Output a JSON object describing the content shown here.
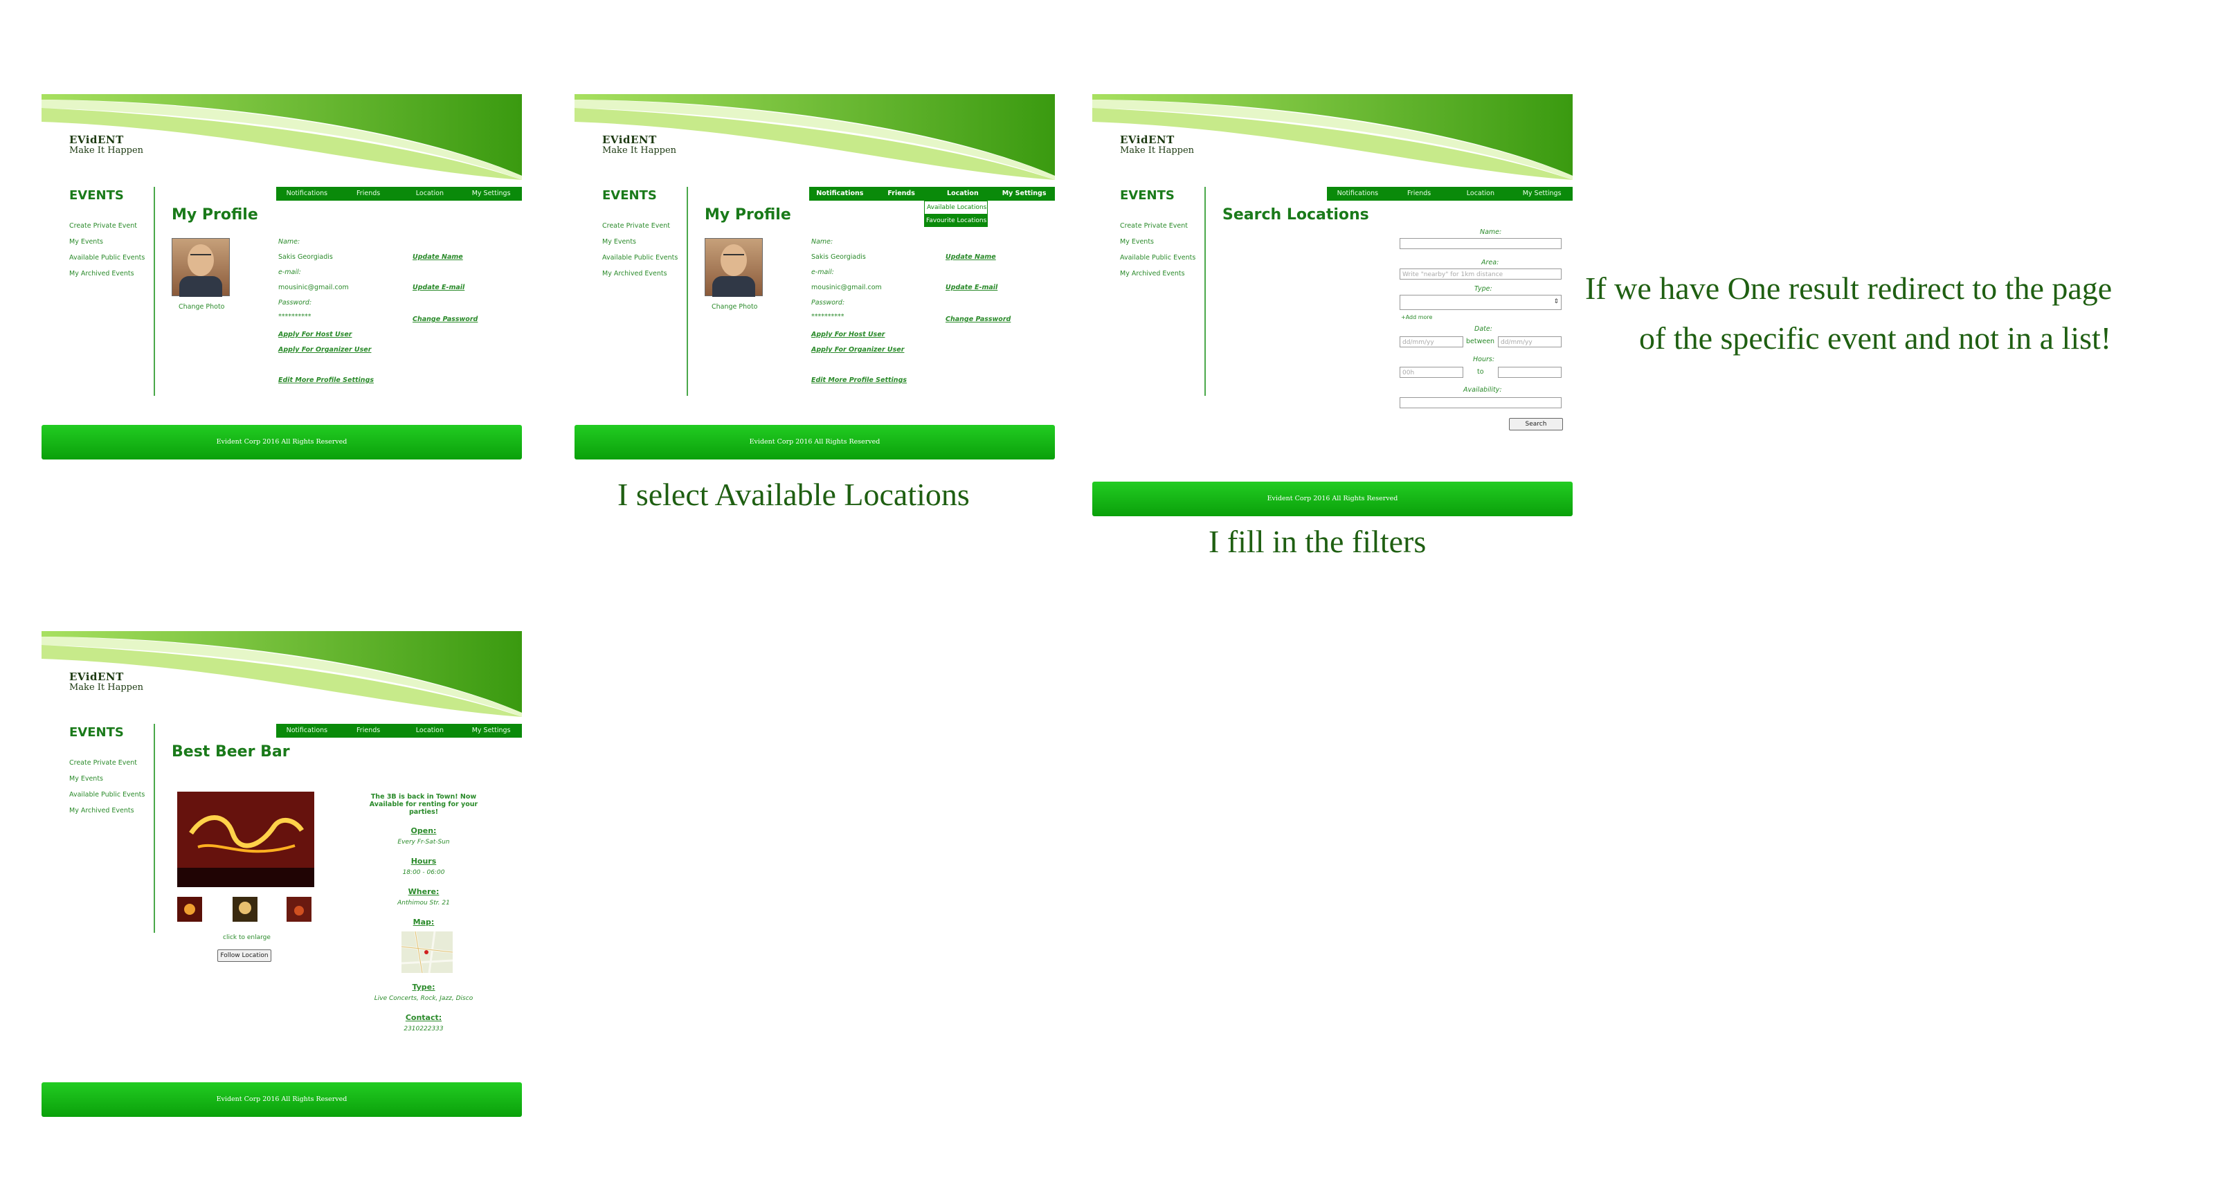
{
  "brand": {
    "name": "EVidENT",
    "slogan": "Make It Happen"
  },
  "sidebar": {
    "title": "EVENTS",
    "links": [
      "Create Private Event",
      "My Events",
      "Available Public Events",
      "My Archived Events"
    ]
  },
  "nav": [
    "Notifications",
    "Friends",
    "Location",
    "My Settings"
  ],
  "footer": "Evident Corp  2016 All Rights Reserved",
  "profile": {
    "title": "My Profile",
    "change_photo": "Change Photo",
    "name_label": "Name:",
    "name_value": "Sakis Georgiadis",
    "email_label": "e-mail:",
    "email_value": "mousinic@gmail.com",
    "password_label": "Password:",
    "password_value": "**********",
    "update_name": "Update Name",
    "update_email": "Update E-mail",
    "change_password": "Change Password",
    "apply_host": "Apply For Host User",
    "apply_organizer": "Apply For Organizer User",
    "edit_more": "Edit More Profile Settings"
  },
  "dropdown": [
    "Available Locations",
    "Favourite Locations"
  ],
  "search": {
    "title": "Search Locations",
    "name_label": "Name:",
    "area_label": "Area:",
    "area_placeholder": "Write \"nearby\" for 1km distance",
    "type_label": "Type:",
    "add_more": "+Add more",
    "date_label": "Date:",
    "date_placeholder_1": "dd/mm/yy",
    "between": "between",
    "date_placeholder_2": "dd/mm/yy",
    "hours_label": "Hours:",
    "hour_placeholder": "00h",
    "to": "to",
    "availability_label": "Availability:",
    "search_button": "Search"
  },
  "location": {
    "title": "Best Beer Bar",
    "headline": "The 3B is back in Town! Now Available for renting for your parties!",
    "open_label": "Open:",
    "open_value": "Every Fr-Sat-Sun",
    "hours_label": "Hours",
    "hours_value": "18:00 - 06:00",
    "where_label": "Where:",
    "where_value": "Anthimou Str. 21",
    "map_label": "Map:",
    "type_label": "Type:",
    "type_value": "Live Concerts, Rock, Jazz, Disco",
    "contact_label": "Contact:",
    "contact_value": "2310222333",
    "click_to_enlarge": "click to enlarge",
    "follow_button": "Follow Location"
  },
  "captions": {
    "step2": "I select Available Locations",
    "step3": "I fill in the filters",
    "note_line1": "If we have One result redirect to the page",
    "note_line2": "of the specific event and not in a list!"
  },
  "colors": {
    "primary_green": "#0a8a0a",
    "text_green": "#1a7a1a",
    "caption": "#1f5f12"
  }
}
